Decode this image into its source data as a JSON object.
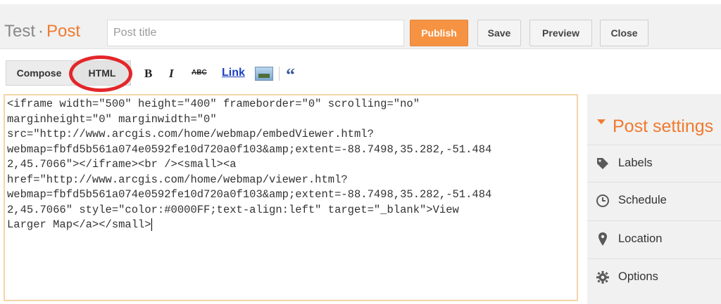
{
  "header": {
    "blog_name": "Test",
    "separator": "·",
    "section": "Post",
    "post_title_placeholder": "Post title",
    "buttons": {
      "publish": "Publish",
      "save": "Save",
      "preview": "Preview",
      "close": "Close"
    }
  },
  "toolbar": {
    "tabs": {
      "compose": "Compose",
      "html": "HTML"
    },
    "active_tab": "HTML",
    "icons": {
      "bold": "B",
      "italic": "I",
      "strikethrough": "ABC",
      "link": "Link",
      "image": "image-icon",
      "quote": "“"
    }
  },
  "editor": {
    "lines": [
      "<iframe width=\"500\" height=\"400\" frameborder=\"0\" scrolling=\"no\"",
      "marginheight=\"0\" marginwidth=\"0\"",
      "src=\"http://www.arcgis.com/home/webmap/embedViewer.html?",
      "webmap=fbfd5b561a074e0592fe10d720a0f103&amp;extent=-88.7498,35.282,-51.484",
      "2,45.7066\"></iframe><br /><small><a",
      "href=\"http://www.arcgis.com/home/webmap/viewer.html?",
      "webmap=fbfd5b561a074e0592fe10d720a0f103&amp;extent=-88.7498,35.282,-51.484",
      "2,45.7066\" style=\"color:#0000FF;text-align:left\" target=\"_blank\">View",
      "Larger Map</a></small>"
    ]
  },
  "sidebar": {
    "title": "Post settings",
    "items": [
      {
        "label": "Labels",
        "icon": "tag-icon"
      },
      {
        "label": "Schedule",
        "icon": "clock-icon"
      },
      {
        "label": "Location",
        "icon": "map-pin-icon"
      },
      {
        "label": "Options",
        "icon": "gear-icon"
      }
    ]
  },
  "colors": {
    "accent": "#f07a2e",
    "publish_bg": "#f69343",
    "highlight_ring": "#e3262a"
  }
}
